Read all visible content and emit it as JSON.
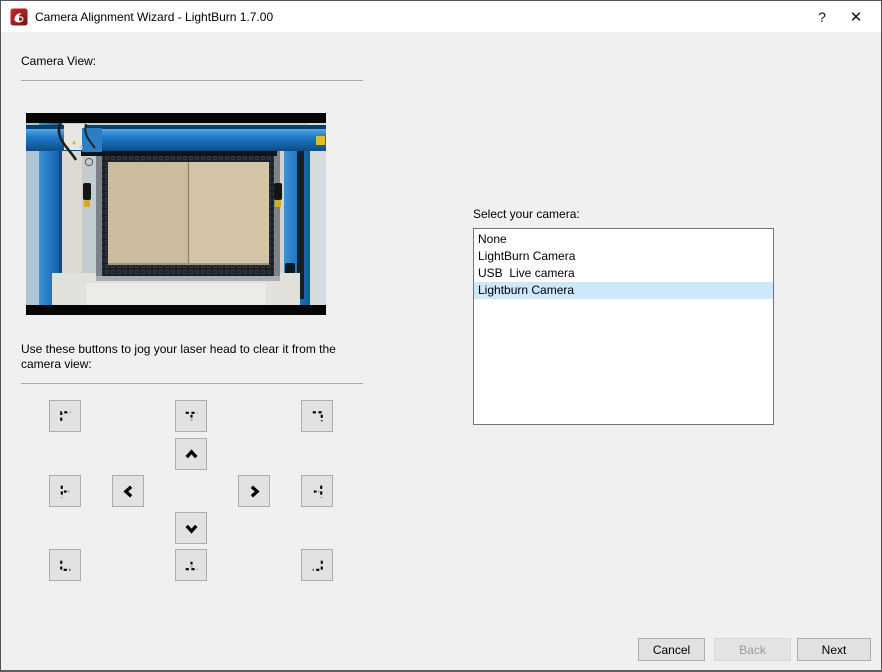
{
  "window": {
    "title": "Camera Alignment Wizard - LightBurn 1.7.00",
    "help_label": "?",
    "close_label": "✕"
  },
  "left_panel": {
    "camera_view_label": "Camera View:",
    "jog_instructions": "Use these buttons to jog your laser head to clear it from the camera view:",
    "camera_preview_description": "live photo of laser cutter interior: blue machine frame, honeycomb bed, two tan wood sheets",
    "jog_buttons": [
      {
        "name": "jog-corner-top-left",
        "icon": "corner-top-left-icon"
      },
      {
        "name": "jog-edge-top",
        "icon": "edge-top-icon"
      },
      {
        "name": "jog-corner-top-right",
        "icon": "corner-top-right-icon"
      },
      {
        "name": "jog-up",
        "icon": "chevron-up-icon"
      },
      {
        "name": "jog-edge-left",
        "icon": "edge-left-icon"
      },
      {
        "name": "jog-left",
        "icon": "chevron-left-icon"
      },
      {
        "name": "jog-right",
        "icon": "chevron-right-icon"
      },
      {
        "name": "jog-edge-right",
        "icon": "edge-right-icon"
      },
      {
        "name": "jog-down",
        "icon": "chevron-down-icon"
      },
      {
        "name": "jog-corner-bottom-left",
        "icon": "corner-bottom-left-icon"
      },
      {
        "name": "jog-edge-bottom",
        "icon": "edge-bottom-icon"
      },
      {
        "name": "jog-corner-bottom-right",
        "icon": "corner-bottom-right-icon"
      }
    ]
  },
  "right_panel": {
    "select_camera_label": "Select your camera:",
    "camera_list": {
      "items": [
        "None",
        "LightBurn Camera",
        "USB  Live camera",
        "Lightburn Camera"
      ],
      "selected_index": 3,
      "selected_value": "Lightburn Camera"
    }
  },
  "footer": {
    "cancel_label": "Cancel",
    "back_label": "Back",
    "next_label": "Next",
    "back_enabled": false
  },
  "colors": {
    "titlebar_bg": "#ffffff",
    "dialog_bg": "#f0f0f0",
    "selection_highlight": "#cde7fb",
    "button_bg": "#e1e1e1",
    "button_border": "#adadad",
    "list_border": "#70757d",
    "logo_red": "#a91e22",
    "machine_blue": "#1f7cc8",
    "wood_tan": "#cfc0a2"
  }
}
